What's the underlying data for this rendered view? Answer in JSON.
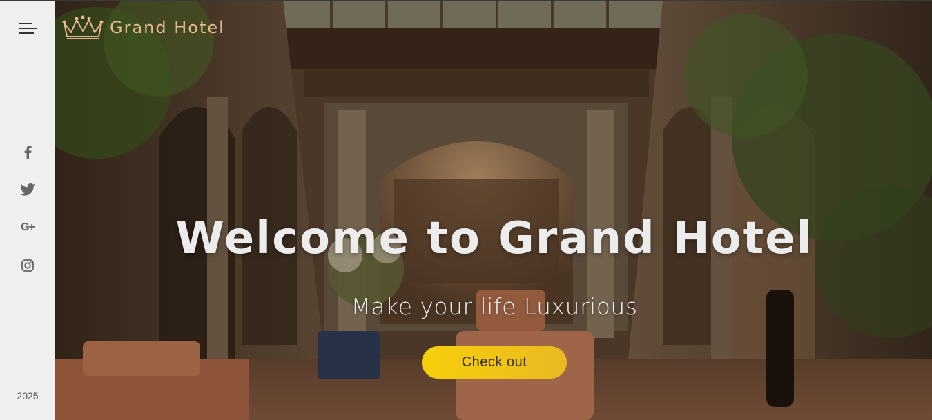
{
  "brand": {
    "name": "Grand Hotel",
    "icon": "crown-icon",
    "color": "#e6b98d"
  },
  "sidebar": {
    "menu_icon": "hamburger-menu-icon",
    "social": [
      {
        "name": "facebook",
        "icon": "facebook-icon"
      },
      {
        "name": "twitter",
        "icon": "twitter-icon"
      },
      {
        "name": "google-plus",
        "icon": "google-plus-icon",
        "glyph": "G+"
      },
      {
        "name": "instagram",
        "icon": "instagram-icon"
      }
    ],
    "year": "2025"
  },
  "hero": {
    "title": "Welcome to Grand Hotel",
    "subtitle": "Make your life Luxurious",
    "cta_label": "Check out",
    "cta_color": "#f6cf0a"
  }
}
